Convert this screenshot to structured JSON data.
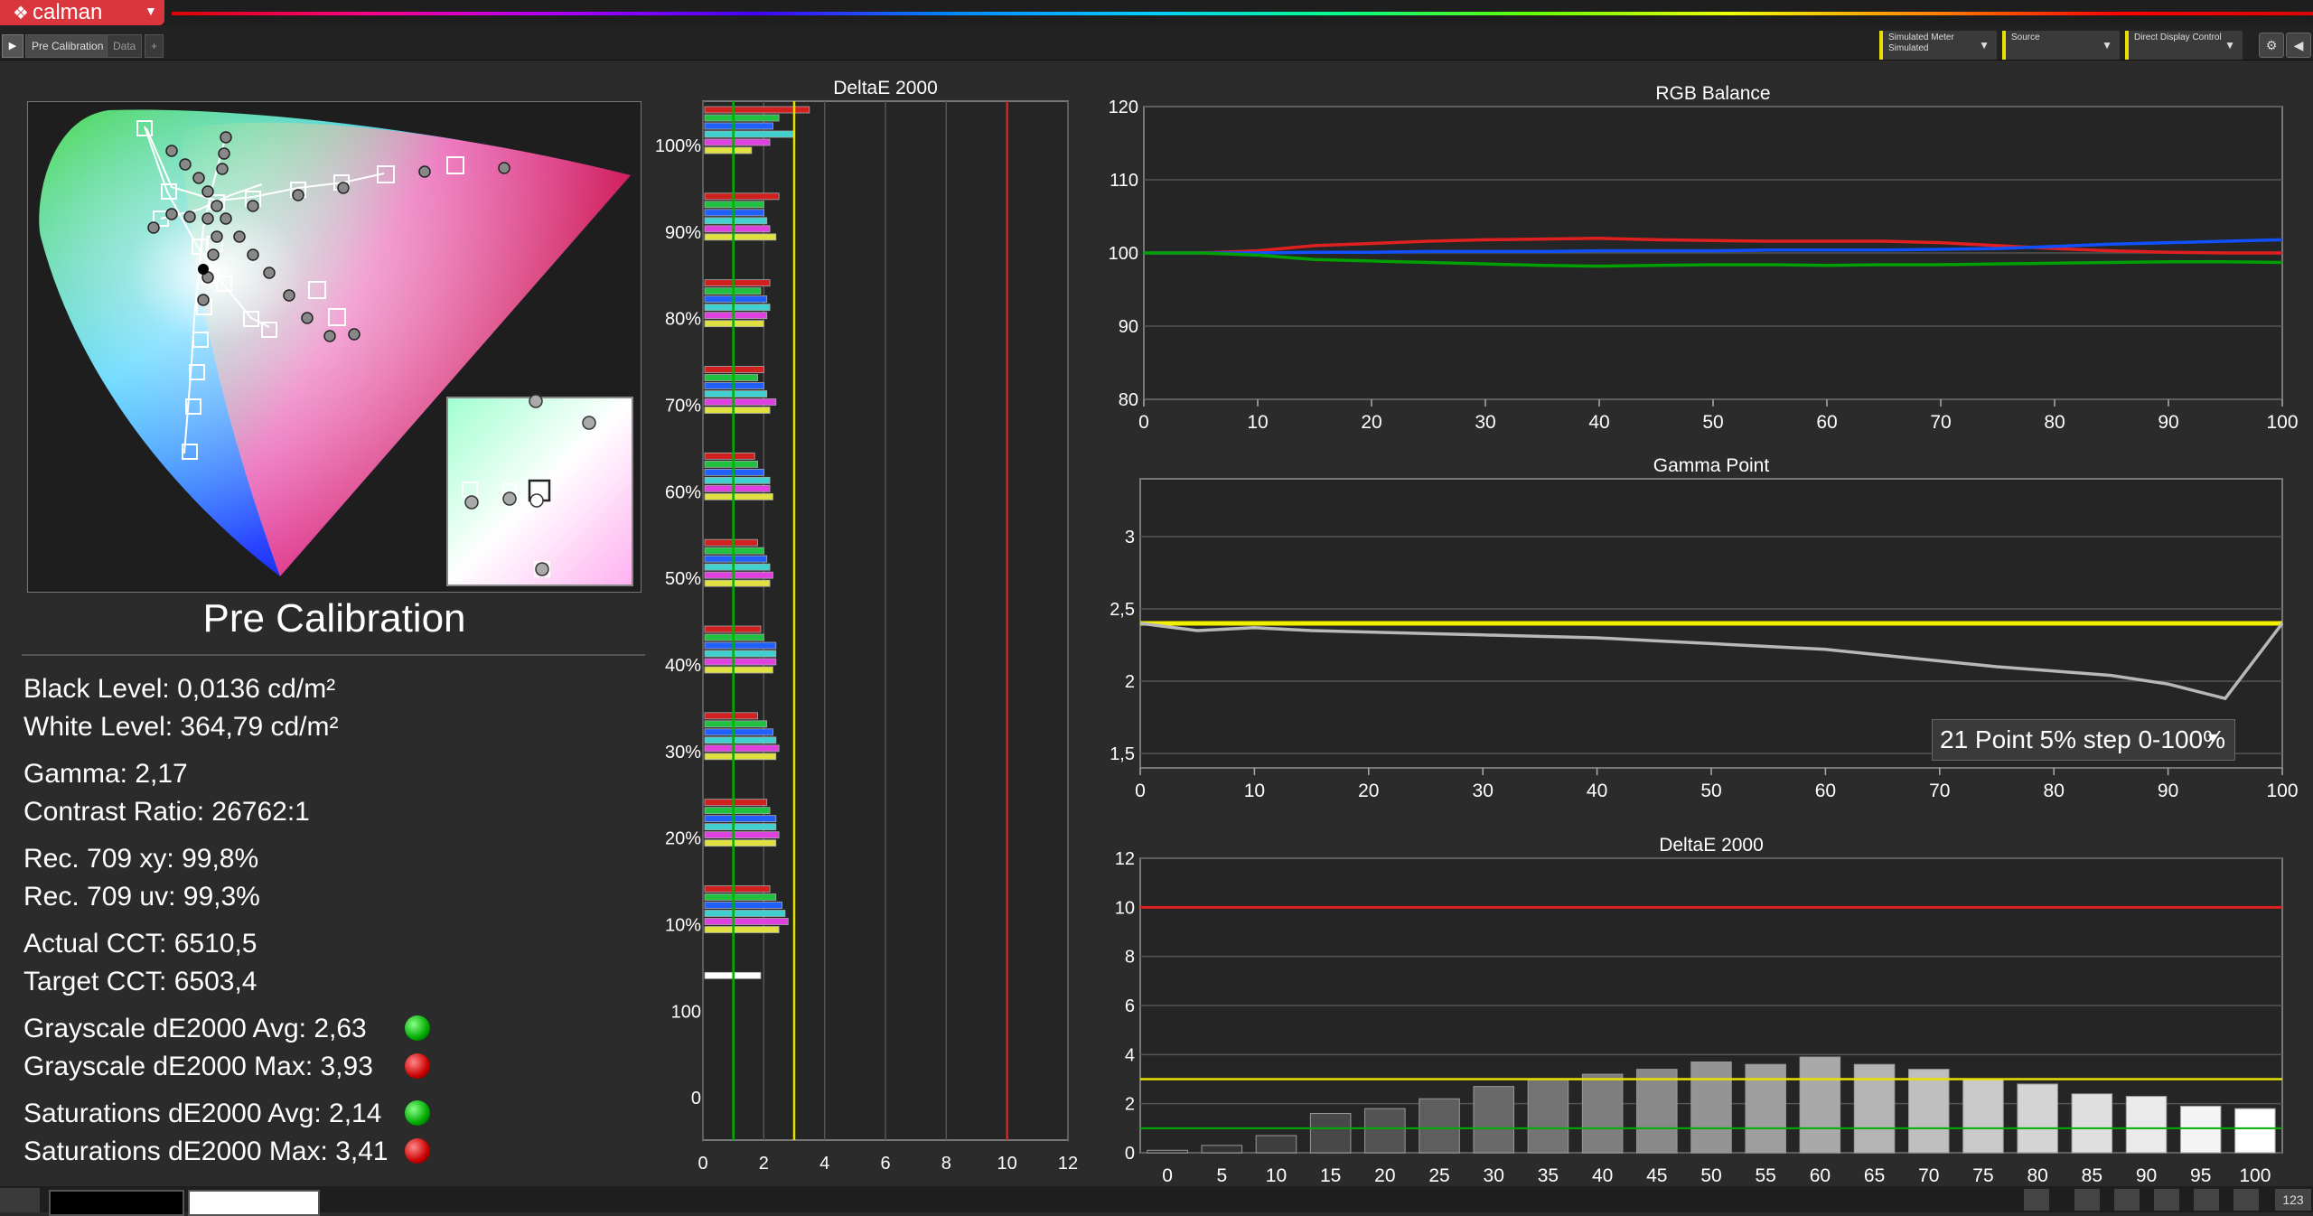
{
  "app": {
    "logo": "calman",
    "tabs": [
      "Pre Calibration",
      "Data",
      "+"
    ]
  },
  "controls": [
    {
      "line1": "Simulated Meter",
      "line2": "Simulated"
    },
    {
      "line1": "Source",
      "line2": ""
    },
    {
      "line1": "Direct Display Control",
      "line2": ""
    }
  ],
  "summary": {
    "title": "Pre Calibration",
    "black_level": "Black Level: 0,0136 cd/m²",
    "white_level": "White Level: 364,79 cd/m²",
    "gamma": "Gamma: 2,17",
    "contrast": "Contrast Ratio: 26762:1",
    "rec709_xy": "Rec. 709 xy: 99,8%",
    "rec709_uv": "Rec. 709 uv: 99,3%",
    "actual_cct": "Actual CCT: 6510,5",
    "target_cct": "Target CCT: 6503,4",
    "gs_avg": "Grayscale dE2000 Avg: 2,63",
    "gs_max": "Grayscale dE2000 Max: 3,93",
    "sat_avg": "Saturations dE2000 Avg: 2,14",
    "sat_max": "Saturations dE2000 Max: 3,41",
    "colors": {
      "pass": "#00c000",
      "fail": "#d00000"
    }
  },
  "gamma_selector": "21 Point 5% step 0-100%",
  "status_num": "123",
  "chart_data": [
    {
      "type": "bar",
      "title": "DeltaE 2000",
      "orientation": "horizontal",
      "xlim": [
        0,
        12
      ],
      "xticks": [
        "0",
        "2",
        "4",
        "6",
        "8",
        "10",
        "12"
      ],
      "ylabels": [
        "100%",
        "90%",
        "80%",
        "70%",
        "60%",
        "50%",
        "40%",
        "30%",
        "20%",
        "10%",
        "100",
        "0"
      ],
      "thresholds": {
        "green": 1,
        "yellow": 3,
        "red": 10
      },
      "groups": [
        {
          "label": "100%",
          "values": [
            3.5,
            2.5,
            2.3,
            3.0,
            2.2,
            1.6
          ]
        },
        {
          "label": "90%",
          "values": [
            2.5,
            2.0,
            2.0,
            2.1,
            2.2,
            2.4
          ]
        },
        {
          "label": "80%",
          "values": [
            2.2,
            1.9,
            2.1,
            2.2,
            2.1,
            2.0
          ]
        },
        {
          "label": "70%",
          "values": [
            2.0,
            1.8,
            2.0,
            2.1,
            2.4,
            2.2
          ]
        },
        {
          "label": "60%",
          "values": [
            1.7,
            1.8,
            2.0,
            2.2,
            2.2,
            2.3
          ]
        },
        {
          "label": "50%",
          "values": [
            1.8,
            2.0,
            2.1,
            2.2,
            2.3,
            2.2
          ]
        },
        {
          "label": "40%",
          "values": [
            1.9,
            2.0,
            2.4,
            2.4,
            2.4,
            2.3
          ]
        },
        {
          "label": "30%",
          "values": [
            1.8,
            2.1,
            2.3,
            2.4,
            2.5,
            2.4
          ]
        },
        {
          "label": "20%",
          "values": [
            2.1,
            2.2,
            2.4,
            2.4,
            2.5,
            2.4
          ]
        },
        {
          "label": "10%",
          "values": [
            2.2,
            2.4,
            2.6,
            2.7,
            2.8,
            2.5
          ]
        },
        {
          "label": "100",
          "values": [
            1.9
          ]
        }
      ]
    },
    {
      "type": "line",
      "title": "RGB Balance",
      "x": [
        0,
        5,
        10,
        15,
        20,
        25,
        30,
        35,
        40,
        45,
        50,
        55,
        60,
        65,
        70,
        75,
        80,
        85,
        90,
        95,
        100
      ],
      "xlim": [
        0,
        100
      ],
      "ylim": [
        80,
        120
      ],
      "xticks": [
        "0",
        "10",
        "20",
        "30",
        "40",
        "50",
        "60",
        "70",
        "80",
        "90",
        "100"
      ],
      "yticks": [
        "80",
        "90",
        "100",
        "110",
        "120"
      ],
      "series": [
        {
          "color": "#e02020",
          "values": [
            100,
            100,
            100.3,
            101,
            101.3,
            101.6,
            101.8,
            101.9,
            102,
            101.8,
            101.7,
            101.6,
            101.6,
            101.6,
            101.4,
            101,
            100.6,
            100.3,
            100.1,
            100,
            100
          ]
        },
        {
          "color": "#1050ff",
          "values": [
            100,
            100,
            100,
            100.1,
            100.1,
            100.2,
            100.2,
            100.2,
            100.3,
            100.3,
            100.3,
            100.4,
            100.4,
            100.4,
            100.5,
            100.6,
            100.9,
            101.2,
            101.4,
            101.6,
            101.8
          ]
        },
        {
          "color": "#00a000",
          "values": [
            100,
            100,
            99.7,
            99.1,
            98.9,
            98.7,
            98.5,
            98.3,
            98.2,
            98.3,
            98.4,
            98.4,
            98.3,
            98.4,
            98.4,
            98.5,
            98.6,
            98.7,
            98.8,
            98.8,
            98.7
          ]
        }
      ]
    },
    {
      "type": "line",
      "title": "Gamma Point",
      "x": [
        0,
        5,
        10,
        15,
        20,
        25,
        30,
        35,
        40,
        45,
        50,
        55,
        60,
        65,
        70,
        75,
        80,
        85,
        90,
        95,
        100
      ],
      "xlim": [
        0,
        100
      ],
      "ylim": [
        1.4,
        3.4
      ],
      "xticks": [
        "0",
        "10",
        "20",
        "30",
        "40",
        "50",
        "60",
        "70",
        "80",
        "90",
        "100"
      ],
      "yticks": [
        "1,5",
        "2",
        "2,5",
        "3"
      ],
      "target": 2.4,
      "series": [
        {
          "color": "#b8b8b8",
          "values": [
            2.4,
            2.35,
            2.37,
            2.35,
            2.34,
            2.33,
            2.32,
            2.31,
            2.3,
            2.28,
            2.26,
            2.24,
            2.22,
            2.18,
            2.14,
            2.1,
            2.07,
            2.04,
            1.98,
            1.88,
            2.4
          ]
        }
      ]
    },
    {
      "type": "bar",
      "title": "DeltaE 2000",
      "categories": [
        "0",
        "5",
        "10",
        "15",
        "20",
        "25",
        "30",
        "35",
        "40",
        "45",
        "50",
        "55",
        "60",
        "65",
        "70",
        "75",
        "80",
        "85",
        "90",
        "95",
        "100"
      ],
      "values": [
        0.1,
        0.3,
        0.7,
        1.6,
        1.8,
        2.2,
        2.7,
        3.0,
        3.2,
        3.4,
        3.7,
        3.6,
        3.9,
        3.6,
        3.4,
        3.0,
        2.8,
        2.4,
        2.3,
        1.9,
        1.8
      ],
      "ylim": [
        0,
        12
      ],
      "yticks": [
        "0",
        "2",
        "4",
        "6",
        "8",
        "10",
        "12"
      ],
      "thresholds": {
        "green": 1,
        "yellow": 3,
        "red": 10
      }
    }
  ]
}
